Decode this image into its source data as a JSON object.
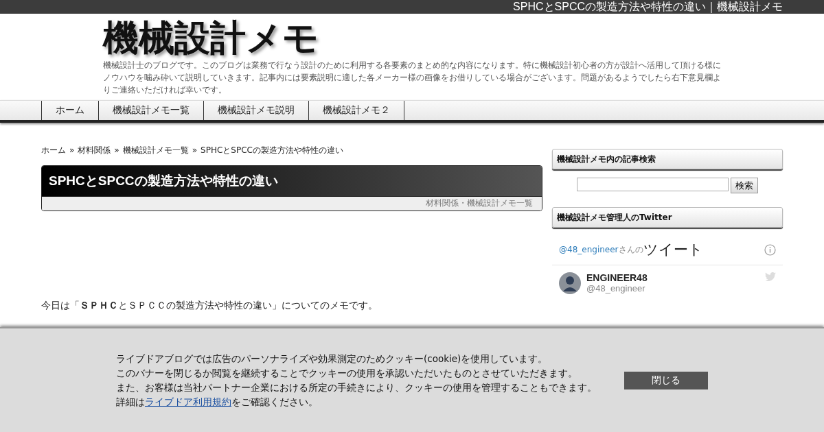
{
  "top_bar": {
    "title": "SPHCとSPCCの製造方法や特性の違い｜機械設計メモ"
  },
  "header": {
    "site_title": "機械設計メモ",
    "description": "機械設計士のブログです。このブログは業務で行なう設計のために利用する各要素のまとめ的な内容になります。特に機械設計初心者の方が設計へ活用して頂ける様にノウハウを噛み砕いて説明していきます。記事内には要素説明に適した各メーカー様の画像をお借りしている場合がございます。問題があるようでしたら右下意見欄よりご連絡いただければ幸いです。"
  },
  "nav": [
    {
      "label": "ホーム"
    },
    {
      "label": "機械設計メモ一覧"
    },
    {
      "label": "機械設計メモ説明"
    },
    {
      "label": "機械設計メモ２"
    }
  ],
  "breadcrumb": [
    {
      "label": "ホーム",
      "sep": "»"
    },
    {
      "label": "材料関係",
      "sep": "»"
    },
    {
      "label": "機械設計メモ一覧",
      "sep": "»"
    },
    {
      "label": "SPHCとSPCCの製造方法や特性の違い"
    }
  ],
  "article": {
    "title": "SPHCとSPCCの製造方法や特性の違い",
    "categories": "材料関係・機械設計メモ一覧",
    "intro": "今日は「**ＳＰＨＣ**とＳＰＣＣの製造方法や特性の違い」についてのメモです。"
  },
  "sidebar": {
    "search_heading": "機械設計メモ内の記事検索",
    "search_button": "検索",
    "twitter_heading": "機械設計メモ管理人のTwitter",
    "timeline": {
      "handle_link": "@48_engineer",
      "handle_suffix": "さんの",
      "title": "ツイート",
      "user_name": "ENGINEER48",
      "user_handle": "@48_engineer"
    }
  },
  "cookie_banner": {
    "lines": [
      "ライブドアブログでは広告のパーソナライズや効果測定のためクッキー(cookie)を使用しています。",
      "このバナーを閉じるか閲覧を継続することでクッキーの使用を承認いただいたものとさせていただきます。",
      "また、お客様は当社パートナー企業における所定の手続きにより、クッキーの使用を管理することもできます。"
    ],
    "detail_prefix": "詳細は",
    "detail_link": "ライブドア利用規約",
    "detail_suffix": "をご確認ください。",
    "close_button": "閉じる"
  }
}
